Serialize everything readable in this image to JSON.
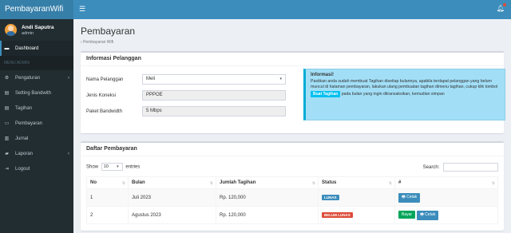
{
  "app": {
    "brand": "PembayaranWifi"
  },
  "user": {
    "name": "Andi Saputra",
    "role": "admin"
  },
  "sidebar": {
    "items": [
      {
        "label": "Dashboard",
        "icon": "dashboard-icon",
        "glyph": "▬",
        "active": true
      },
      {
        "header": "MENU ADMIN"
      },
      {
        "label": "Pengaturan",
        "icon": "gear-icon",
        "glyph": "⚙",
        "caret": "‹"
      },
      {
        "label": "Setting Bandwith",
        "icon": "list-icon",
        "glyph": "▤"
      },
      {
        "label": "Tagihan",
        "icon": "tagihan-icon",
        "glyph": "▤"
      },
      {
        "label": "Pembayaran",
        "icon": "payment-icon",
        "glyph": "▭"
      },
      {
        "label": "Jurnal",
        "icon": "journal-icon",
        "glyph": "▥"
      },
      {
        "label": "Laporan",
        "icon": "report-icon",
        "glyph": "▰",
        "caret": "‹"
      },
      {
        "label": "Logout",
        "icon": "logout-icon",
        "glyph": "⇥"
      }
    ]
  },
  "page": {
    "title": "Pembayaran",
    "breadcrumb": "Pembayaran Wifi"
  },
  "customer_box": {
    "title": "Informasi Pelanggan",
    "fields": {
      "name_label": "Nama Pelanggan",
      "name_value": "Meli",
      "connection_label": "Jenis Koneksi",
      "connection_value": "PPPOE",
      "bandwidth_label": "Paket Bandwidth",
      "bandwidth_value": "5 Mbps"
    },
    "callout": {
      "title": "Informasi!",
      "text_before": "Pastikan anda sudah membuat Tagihan disetiap bulannya, apabila terdapat pelanggan yang belum muncul di halaman pembayaran, lakukan ulang pembuatan tagihan dimenu tagihan, cukup klik tombol",
      "button_label": "Buat Tagihan",
      "text_after": "pada bulan yang ingin ditransaksikan, kemudian simpan"
    }
  },
  "payments_box": {
    "title": "Daftar Pembayaran",
    "show_label": "Show",
    "show_value": "10",
    "entries_label": "entries",
    "search_label": "Search:",
    "columns": [
      "No",
      "Bulan",
      "Jumlah Tagihan",
      "Status",
      "#"
    ],
    "rows": [
      {
        "no": "1",
        "bulan": "Juli 2023",
        "jumlah": "Rp. 120,000",
        "status": "LUNAS",
        "status_color": "#3c8dbc",
        "actions": [
          "Cetak"
        ]
      },
      {
        "no": "2",
        "bulan": "Agustus 2023",
        "jumlah": "Rp. 120,000",
        "status": "BELUM LUNAS",
        "status_color": "#dd4b39",
        "actions": [
          "Bayar",
          "Cetak"
        ]
      }
    ]
  },
  "colors": {
    "topbar": "#3c8dbc",
    "brand": "#367fa9",
    "sidebar": "#222d32",
    "callout": "#a2dff7"
  }
}
